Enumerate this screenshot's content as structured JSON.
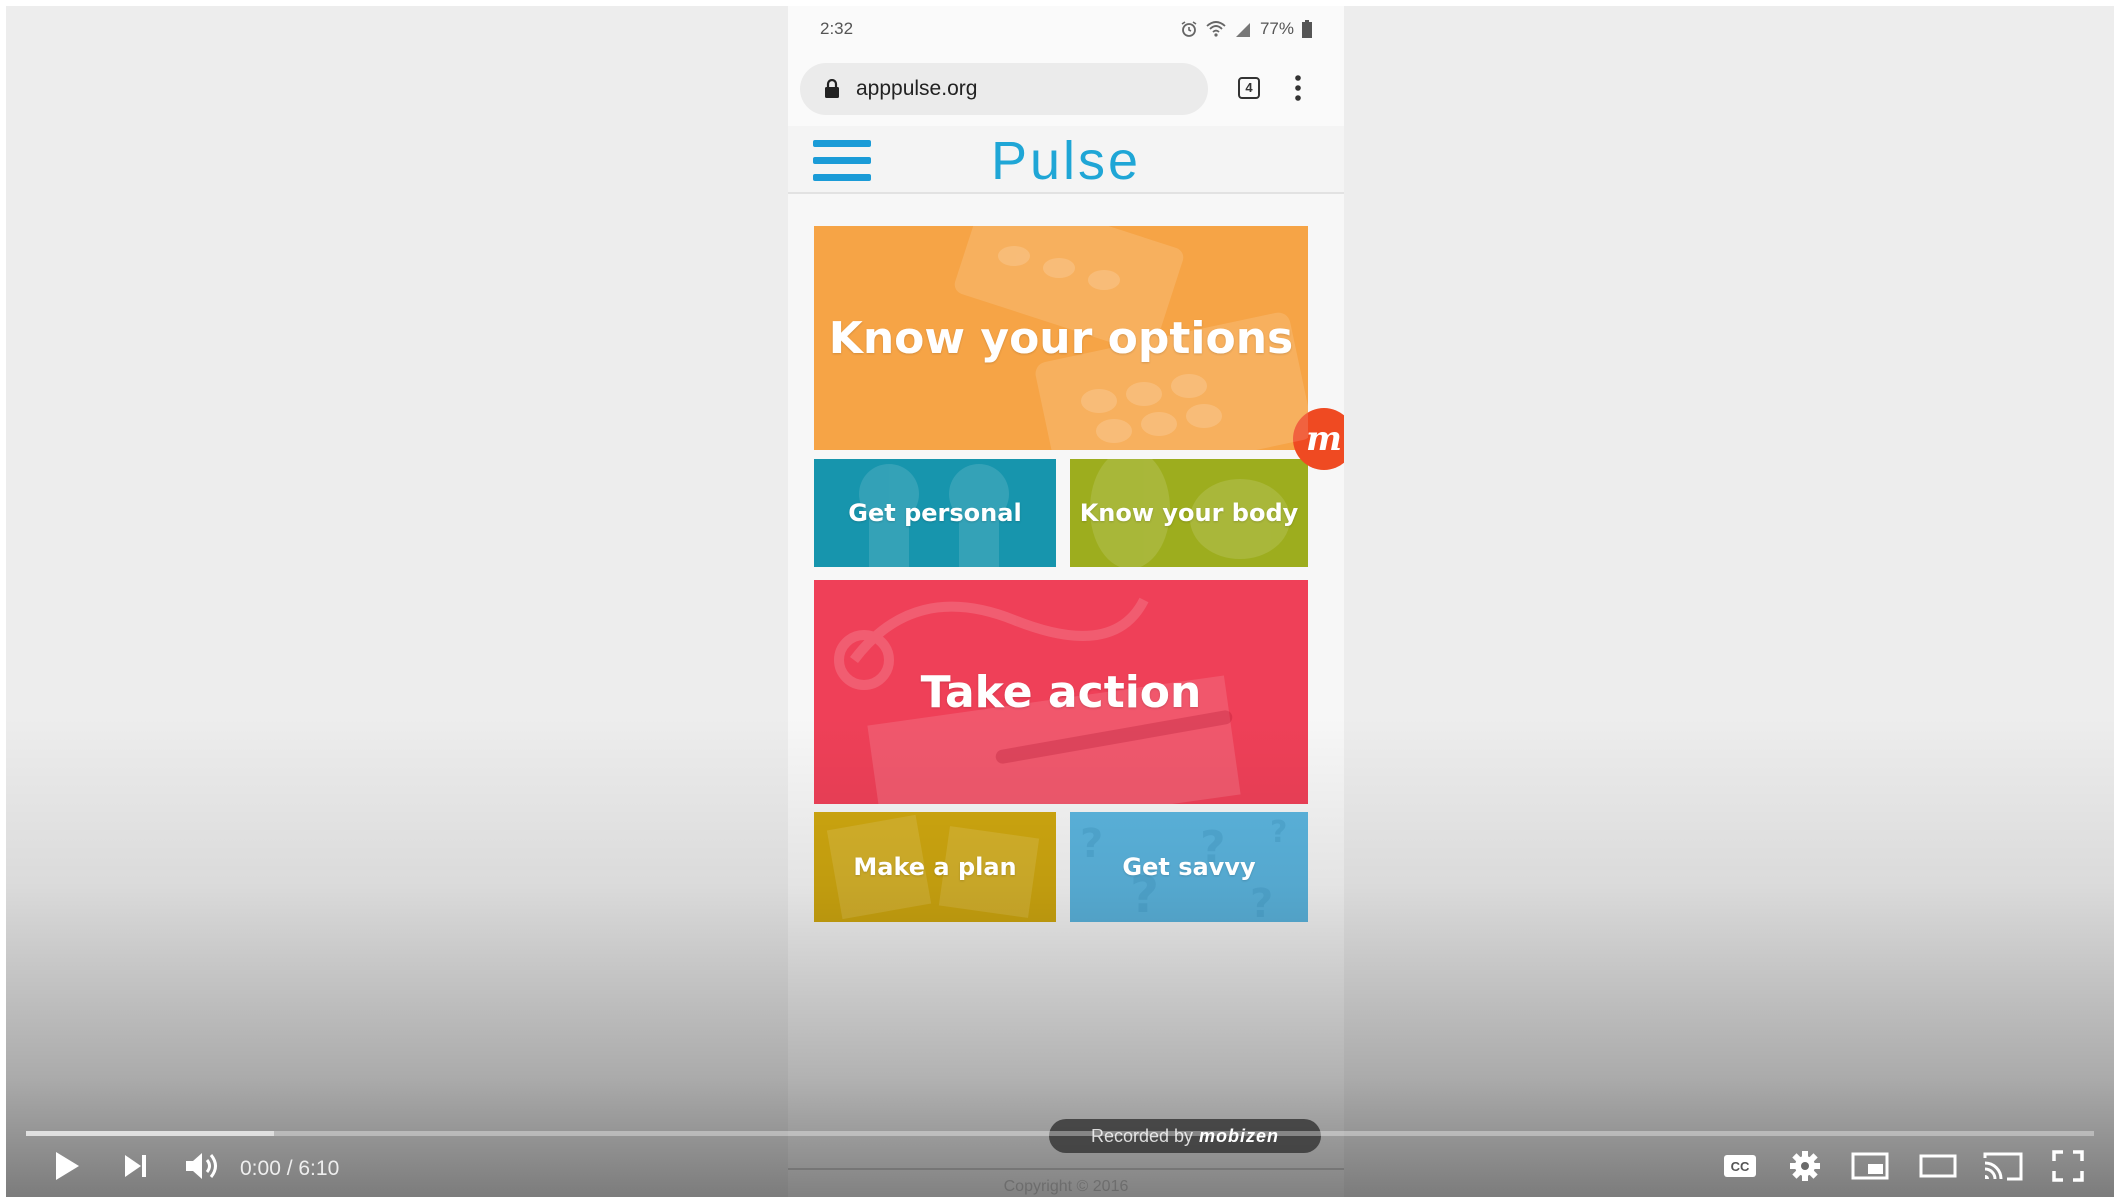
{
  "status_bar": {
    "time": "2:32",
    "battery": "77%"
  },
  "browser": {
    "url": "apppulse.org",
    "tab_count": "4"
  },
  "app": {
    "title": "Pulse"
  },
  "tiles": {
    "know_options": "Know your options",
    "get_personal": "Get personal",
    "know_body": "Know your body",
    "take_action": "Take action",
    "make_plan": "Make a plan",
    "get_savvy": "Get savvy"
  },
  "mobizen_bubble": {
    "letter": "m"
  },
  "footer": {
    "copyright": "Copyright © 2016"
  },
  "watermark": {
    "prefix": "Recorded by",
    "brand": "mobizen"
  },
  "player": {
    "time_display": "0:00 / 6:10",
    "played_fraction": 0.0,
    "buffered_fraction": 0.12,
    "icons": [
      "play-icon",
      "next-icon",
      "volume-icon",
      "captions-icon",
      "settings-icon",
      "miniplayer-icon",
      "theater-mode-icon",
      "cast-icon",
      "fullscreen-icon"
    ]
  },
  "colors": {
    "options_tile": "#f6a446",
    "personal_tile": "#1795ad",
    "body_tile": "#9dad1e",
    "action_tile": "#ef4058",
    "plan_tile": "#d1a910",
    "savvy_tile": "#5cb6e0",
    "brand_blue": "#1fa6d6",
    "mobizen_orange": "#ef4a22"
  }
}
